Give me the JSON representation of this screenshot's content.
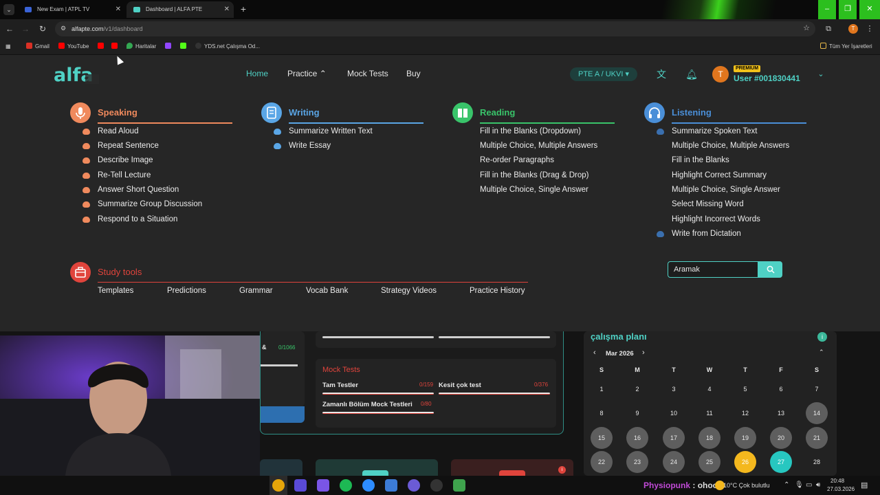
{
  "browser": {
    "tabs": [
      {
        "title": "New Exam | ATPL TV",
        "active": false
      },
      {
        "title": "Dashboard | ALFA PTE",
        "active": true
      }
    ],
    "url_host": "alfapte.com",
    "url_path": "/v1/dashboard",
    "bookmarks": [
      "Gmail",
      "YouTube",
      "Haritalar",
      "YDS.net Çalışma Od..."
    ],
    "all_bookmarks": "Tüm Yer İşaretleri",
    "profile_initial": "T"
  },
  "nav": {
    "links": [
      "Home",
      "Practice",
      "Mock Tests",
      "Buy"
    ],
    "pte_select": "PTE A / UKVI",
    "premium_badge": "PREMIUM",
    "user_initial": "T",
    "user_name": "User #001830441"
  },
  "mega_menu": {
    "speaking": {
      "title": "Speaking",
      "items": [
        "Read Aloud",
        "Repeat Sentence",
        "Describe Image",
        "Re-Tell Lecture",
        "Answer Short Question",
        "Summarize Group Discussion",
        "Respond to a Situation"
      ]
    },
    "writing": {
      "title": "Writing",
      "items": [
        "Summarize Written Text",
        "Write Essay"
      ]
    },
    "reading": {
      "title": "Reading",
      "items": [
        "Fill in the Blanks (Dropdown)",
        "Multiple Choice, Multiple Answers",
        "Re-order Paragraphs",
        "Fill in the Blanks (Drag & Drop)",
        "Multiple Choice, Single Answer"
      ]
    },
    "listening": {
      "title": "Listening",
      "items": [
        "Summarize Spoken Text",
        "Multiple Choice, Multiple Answers",
        "Fill in the Blanks",
        "Highlight Correct Summary",
        "Multiple Choice, Single Answer",
        "Select Missing Word",
        "Highlight Incorrect Words",
        "Write from Dictation"
      ]
    },
    "study_tools": {
      "title": "Study tools",
      "items": [
        "Templates",
        "Predictions",
        "Grammar",
        "Vocab Bank",
        "Strategy Videos",
        "Practice History"
      ]
    },
    "search_placeholder": "Aramak"
  },
  "dashboard": {
    "partial_label": "&",
    "partial_count": "0/1066",
    "mock_tests": {
      "title": "Mock Tests",
      "items": [
        {
          "label": "Tam Testler",
          "count": "0/159"
        },
        {
          "label": "Kesit çok test",
          "count": "0/376"
        },
        {
          "label": "Zamanlı Bölüm Mock Testleri",
          "count": "0/80"
        }
      ]
    }
  },
  "calendar": {
    "title": "çalışma planı",
    "month": "Mar 2026",
    "days_of_week": [
      "S",
      "M",
      "T",
      "W",
      "T",
      "F",
      "S"
    ],
    "weeks": [
      [
        "1",
        "2",
        "3",
        "4",
        "5",
        "6",
        "7"
      ],
      [
        "8",
        "9",
        "10",
        "11",
        "12",
        "13",
        "14"
      ],
      [
        "15",
        "16",
        "17",
        "18",
        "19",
        "20",
        "21"
      ],
      [
        "22",
        "23",
        "24",
        "25",
        "26",
        "27",
        "28"
      ]
    ],
    "today": "26",
    "selected": "27"
  },
  "taskbar": {
    "now_playing_artist": "Physiopunk",
    "now_playing_track": "ohooo",
    "weather": "10°C  Çok bulutlu",
    "time": "20:48",
    "date": "27.03.2026"
  },
  "colors": {
    "accent": "#4fd1c5",
    "speaking": "#f08a5d",
    "writing": "#5aa6e6",
    "reading": "#39c46a",
    "listening": "#4a8fd8",
    "study_tools": "#e0443c",
    "premium": "#f4c21a"
  }
}
